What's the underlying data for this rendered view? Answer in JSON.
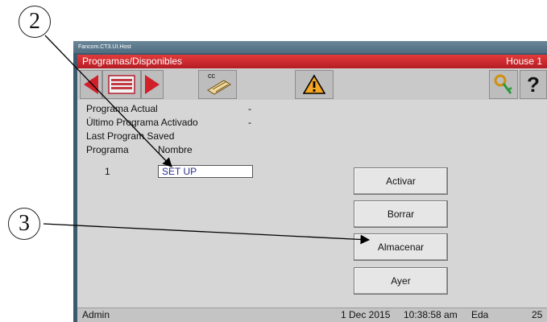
{
  "callouts": {
    "c2": "2",
    "c3": "3"
  },
  "window": {
    "host_title": "Fancom.CT3.UI.Host"
  },
  "header": {
    "title": "Programas/Disponibles",
    "house": "House 1"
  },
  "toolbar": {
    "cc_label": "cc",
    "help_label": "?",
    "icons": [
      "back-arrow-icon",
      "list-icon",
      "forward-arrow-icon",
      "cc-keyboard-icon",
      "warning-icon",
      "key-icon",
      "help-icon"
    ]
  },
  "info": {
    "current_label": "Programa Actual",
    "current_value": "-",
    "last_activated_label": "Último Programa Activado",
    "last_activated_value": "-",
    "last_saved_label": "Last Program Saved",
    "col_program": "Programa",
    "col_name": "Nombre"
  },
  "row": {
    "number": "1",
    "name": "SET UP"
  },
  "buttons": {
    "activate": "Activar",
    "delete": "Borrar",
    "store": "Almacenar",
    "yesterday": "Ayer"
  },
  "status": {
    "user": "Admin",
    "date": "1 Dec 2015",
    "time": "10:38:58 am",
    "mode": "Eda",
    "number": "25"
  },
  "colors": {
    "accent_red": "#d42a2e",
    "window_frame": "#3c5a6e",
    "client_bg": "#d6d6d6"
  }
}
